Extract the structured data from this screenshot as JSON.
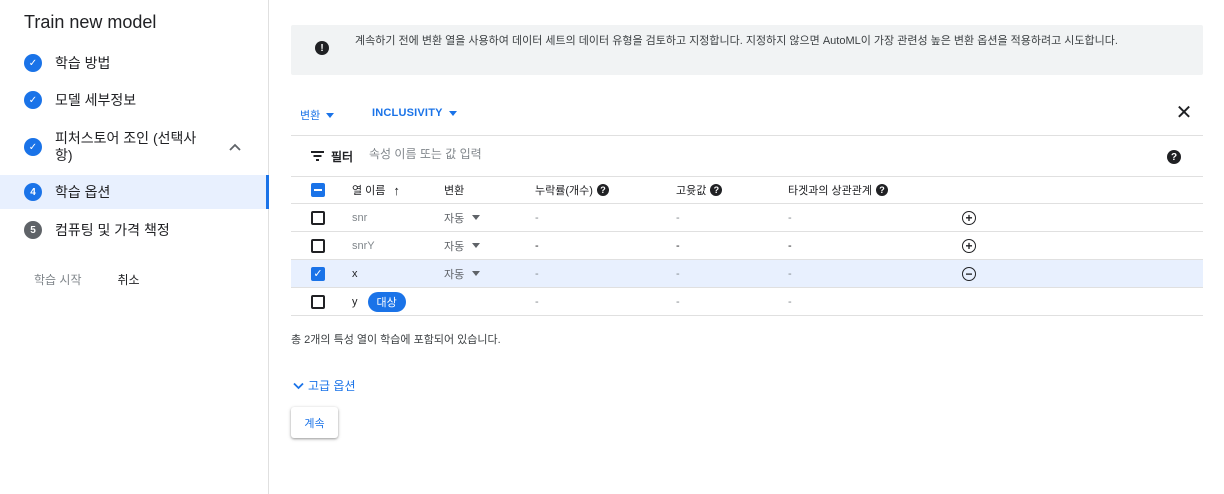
{
  "sidebar": {
    "title": "Train new model",
    "steps": [
      {
        "label": "학습 방법",
        "state": "done"
      },
      {
        "label": "모델 세부정보",
        "state": "done"
      },
      {
        "label_line1": "피처스토어 조인 (선택사",
        "label_line2": "항)",
        "state": "done"
      },
      {
        "number": "4",
        "label": "학습 옵션",
        "state": "active"
      },
      {
        "number": "5",
        "label": "컴퓨팅 및 가격 책정",
        "state": "todo"
      }
    ],
    "start_training": "학습 시작",
    "cancel": "취소",
    "check_glyph": "✓"
  },
  "info": {
    "icon": "info-icon",
    "text": "계속하기 전에 변환 열을 사용하여 데이터 세트의 데이터 유형을 검토하고 지정합니다. 지정하지 않으면 AutoML이 가장 관련성 높은 변환 옵션을 적용하려고 시도합니다."
  },
  "toolbar": {
    "transform_label": "변환",
    "inclusivity_label": "INCLUSIVITY",
    "close_glyph": "✕"
  },
  "filter": {
    "label": "필터",
    "placeholder": "속성 이름 또는 값 입력"
  },
  "table": {
    "headers": {
      "name": "열 이름",
      "sort_glyph": "↑",
      "transform": "변환",
      "missing": "누락률(개수)",
      "unique": "고윳값",
      "correlation": "타겟과의 상관관계"
    },
    "rows": [
      {
        "name": "snr",
        "transform": "자동",
        "missing": "-",
        "unique": "-",
        "correlation": "-",
        "action": "⊕",
        "checked": false
      },
      {
        "name": "snrY",
        "transform": "자동",
        "missing": "-",
        "unique": "-",
        "correlation": "-",
        "action": "⊕",
        "checked": false
      },
      {
        "name": "x",
        "transform": "자동",
        "missing": "-",
        "unique": "-",
        "correlation": "-",
        "action": "⊖",
        "checked": true
      },
      {
        "name": "y",
        "badge": "대상",
        "missing": "-",
        "unique": "-",
        "correlation": "-",
        "checked": false
      }
    ]
  },
  "summary": "총 2개의 특성 열이 학습에 포함되어 있습니다.",
  "advanced": "고급 옵션",
  "continue": "계속",
  "colors": {
    "accent": "#1a73e8",
    "selected_row": "#e8f0fe",
    "banner": "#f1f3f4"
  }
}
